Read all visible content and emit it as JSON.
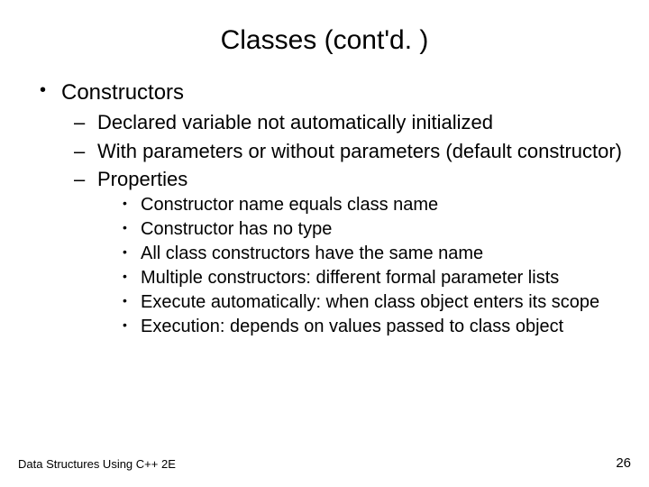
{
  "title": "Classes (cont'd. )",
  "level1": {
    "items": [
      {
        "text": "Constructors"
      }
    ]
  },
  "level2": {
    "items": [
      {
        "text": "Declared variable not automatically initialized"
      },
      {
        "text": "With parameters or without parameters (default constructor)"
      },
      {
        "text": "Properties"
      }
    ]
  },
  "level3": {
    "items": [
      {
        "text": "Constructor name equals class name"
      },
      {
        "text": "Constructor has no type"
      },
      {
        "text": "All class constructors have the same name"
      },
      {
        "text": "Multiple constructors: different formal parameter lists"
      },
      {
        "text": "Execute automatically: when class object enters its scope"
      },
      {
        "text": "Execution: depends on values passed to class object"
      }
    ]
  },
  "footer": {
    "left": "Data Structures Using C++ 2E",
    "page": "26"
  }
}
